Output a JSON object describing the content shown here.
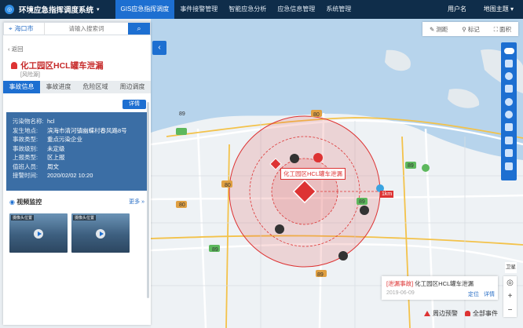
{
  "header": {
    "app_title": "环境应急指挥调度系统",
    "nav": [
      "GIS应急指挥调度",
      "事件接警管理",
      "智能应急分析",
      "应急信息管理",
      "系统管理"
    ],
    "user": "用户名",
    "theme": "地图主题"
  },
  "search": {
    "city": "海口市",
    "placeholder": "请输入搜索词"
  },
  "incident": {
    "back": "返回",
    "title": "化工园区HCL罐车泄漏",
    "tag": "[风险源]",
    "tabs": [
      "事故信息",
      "事故进度",
      "危险区域",
      "周边调度"
    ],
    "detail_btn": "详情",
    "info": [
      {
        "label": "污染物名称:",
        "value": "hcl"
      },
      {
        "label": "发生地点:",
        "value": "滨海市清河镇幽蝶村春风路8号"
      },
      {
        "label": "事故类型:",
        "value": "重点污染企业"
      },
      {
        "label": "事故级别:",
        "value": "未定级"
      },
      {
        "label": "上报类型:",
        "value": "区上报"
      },
      {
        "label": "值班人员:",
        "value": "周文"
      },
      {
        "label": "接警时间:",
        "value": "2020/02/02 10:20"
      }
    ]
  },
  "video": {
    "title": "视频监控",
    "more": "更多",
    "thumb_label": "摄像头位置"
  },
  "toolbar": {
    "measure": "测距",
    "mark": "标记",
    "area": "面积"
  },
  "map": {
    "incident_label": "化工园区HCL罐车泄漏",
    "radius_label": "1km",
    "road_labels": [
      "89",
      "89",
      "89",
      "89",
      "89",
      "80",
      "80",
      "80",
      "89"
    ],
    "satellite": "卫星",
    "zoom_in": "+",
    "zoom_out": "−",
    "popup": {
      "type": "[泄漏事故]",
      "name": "化工园区HCL罐车泄漏",
      "date": "2019-06-09",
      "locate": "定位",
      "detail": "详情"
    },
    "bottom": {
      "nearby": "周边预警",
      "all": "全部事件"
    }
  },
  "colors": {
    "accent": "#1d6fd1",
    "danger": "#d33333",
    "header_bg": "#0f2d4a"
  }
}
